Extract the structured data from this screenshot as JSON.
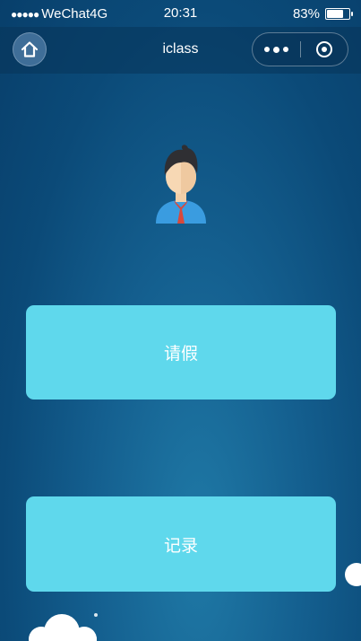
{
  "status_bar": {
    "signal_dots": "●●●●●",
    "carrier": "WeChat4G",
    "time": "20:31",
    "battery_percent": "83%",
    "battery_level": 0.83
  },
  "nav": {
    "title": "iclass",
    "home_icon": "home-icon",
    "more_icon": "more-dots-icon",
    "close_icon": "close-ring-icon"
  },
  "avatar": {
    "icon": "student-avatar-icon"
  },
  "buttons": {
    "leave_label": "请假",
    "record_label": "记录"
  },
  "colors": {
    "button_bg": "#5fd8ec",
    "background_top": "#083f6b",
    "background_mid": "#1f79a6"
  }
}
